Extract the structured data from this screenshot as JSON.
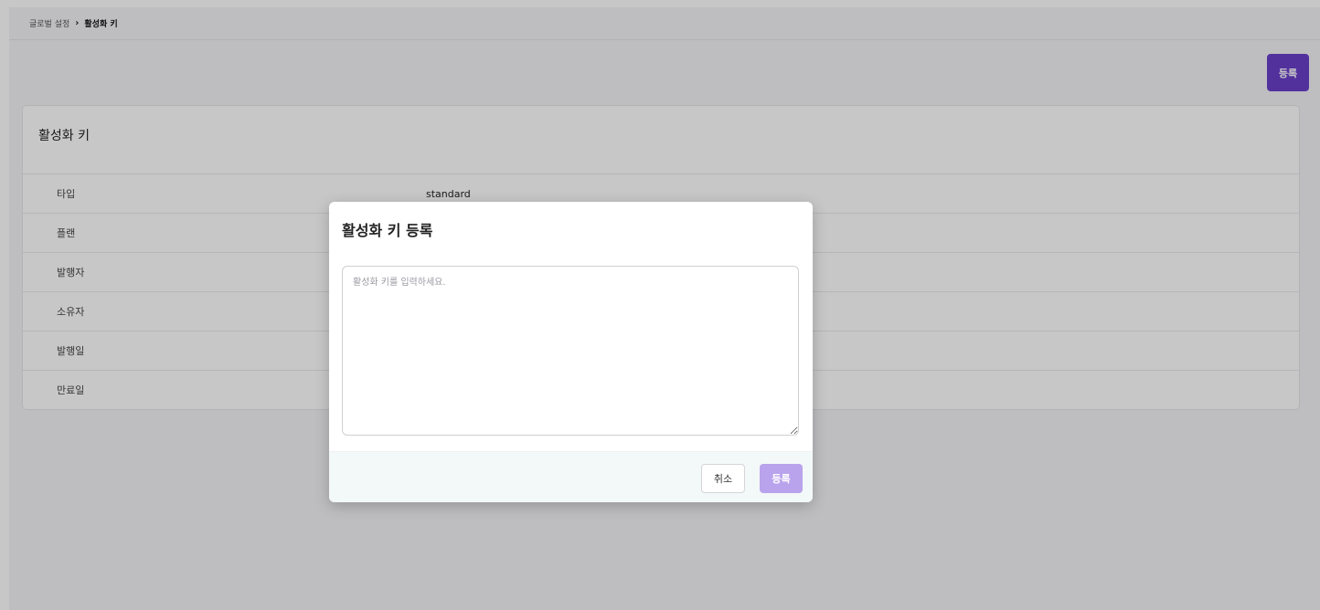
{
  "breadcrumb": {
    "parent": "글로벌 설정",
    "separator": "›",
    "current": "활성화 키"
  },
  "header": {
    "register_label": "등록"
  },
  "card": {
    "title": "활성화 키",
    "rows": [
      {
        "label": "타입",
        "value": "standard"
      },
      {
        "label": "플랜",
        "value": ""
      },
      {
        "label": "발행자",
        "value": ""
      },
      {
        "label": "소유자",
        "value": ""
      },
      {
        "label": "발행일",
        "value": ""
      },
      {
        "label": "만료일",
        "value": ""
      }
    ]
  },
  "modal": {
    "title": "활성화 키 등록",
    "textarea_placeholder": "활성화 키를 입력하세요.",
    "cancel_label": "취소",
    "submit_label": "등록"
  },
  "colors": {
    "primary": "#6a3fc9",
    "primary_disabled": "#b9a3ec"
  }
}
